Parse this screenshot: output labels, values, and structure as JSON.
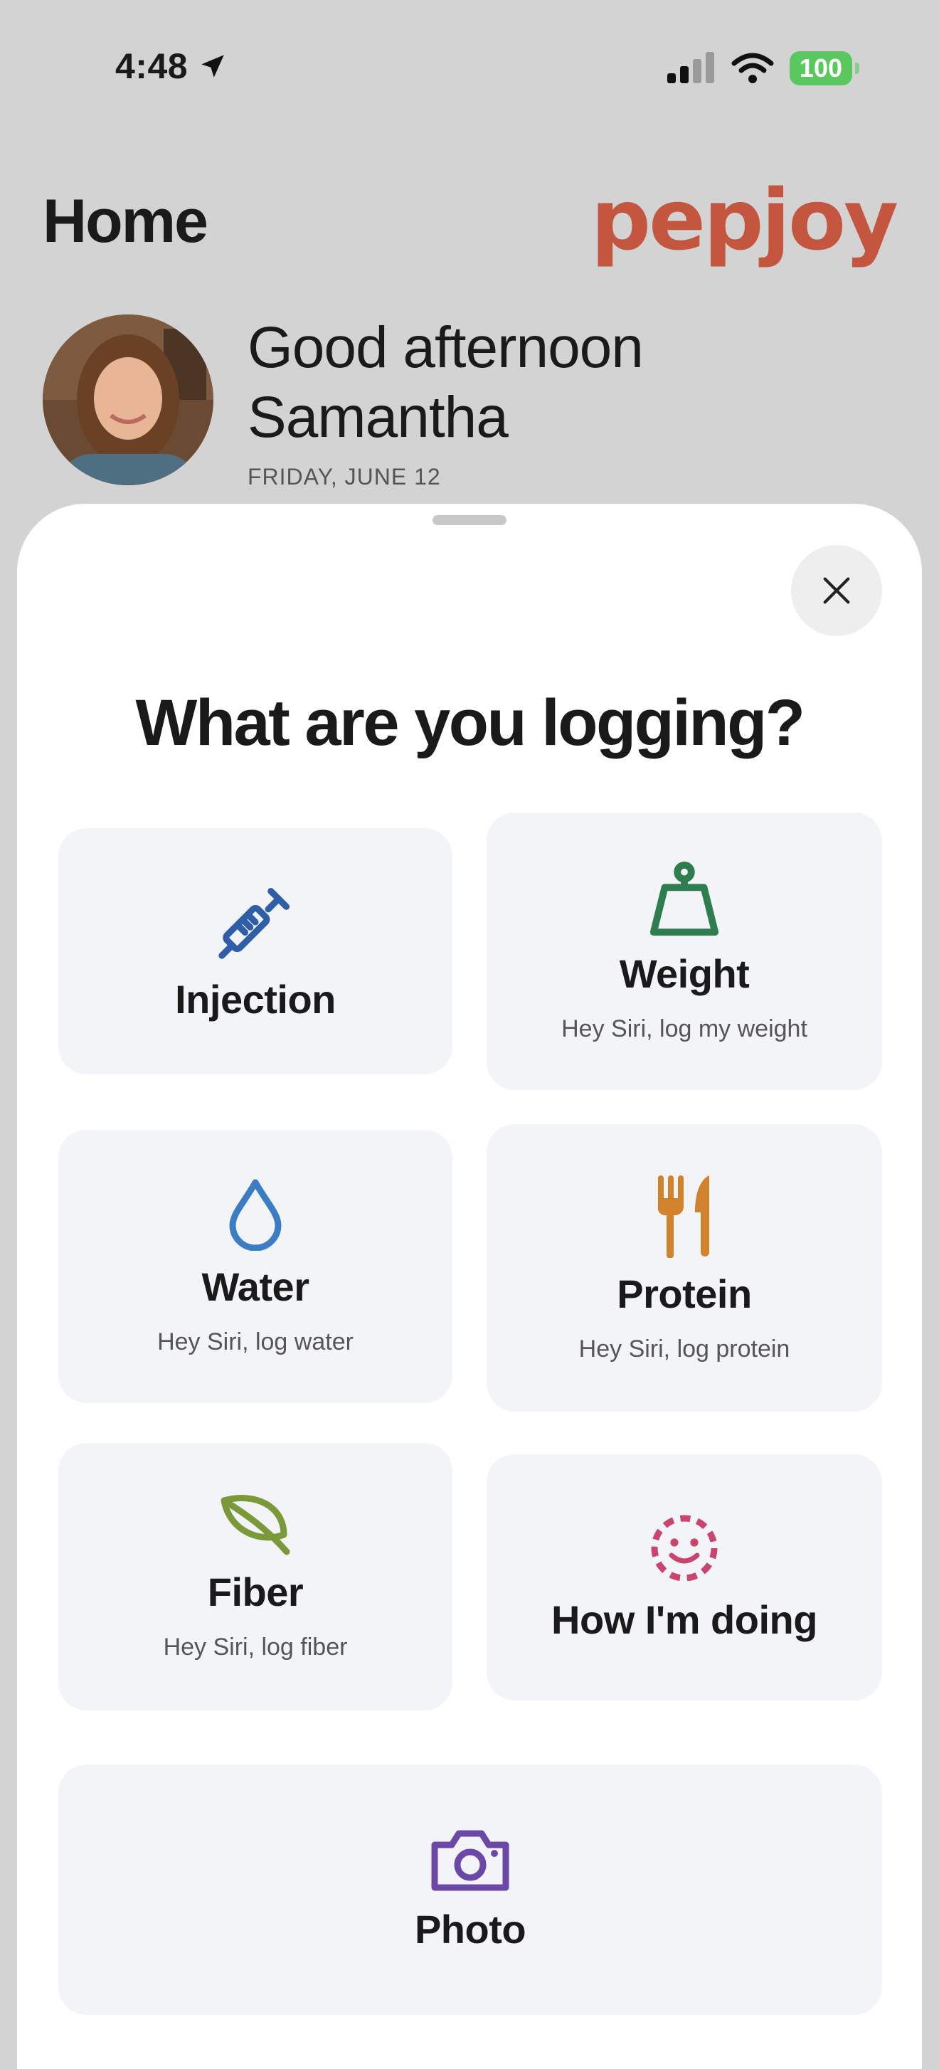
{
  "status_bar": {
    "time": "4:48",
    "battery": "100"
  },
  "header": {
    "title": "Home",
    "brand": "pepjoy"
  },
  "greeting": {
    "line1": "Good afternoon",
    "line2": "Samantha",
    "date": "FRIDAY, JUNE 12"
  },
  "sheet": {
    "title": "What are you logging?",
    "options": [
      {
        "label": "Injection",
        "hint": "",
        "icon": "syringe-icon",
        "color": "#2f5ea8"
      },
      {
        "label": "Weight",
        "hint": "Hey Siri, log my weight",
        "icon": "weight-icon",
        "color": "#2e7d4f"
      },
      {
        "label": "Water",
        "hint": "Hey Siri, log water",
        "icon": "water-drop-icon",
        "color": "#3b7dc4"
      },
      {
        "label": "Protein",
        "hint": "Hey Siri, log protein",
        "icon": "fork-knife-icon",
        "color": "#d1822c"
      },
      {
        "label": "Fiber",
        "hint": "Hey Siri, log fiber",
        "icon": "leaf-icon",
        "color": "#7a9a3a"
      },
      {
        "label": "How I'm doing",
        "hint": "",
        "icon": "mood-icon",
        "color": "#c9456e"
      },
      {
        "label": "Photo",
        "hint": "",
        "icon": "camera-icon",
        "color": "#6b47a8"
      }
    ]
  }
}
